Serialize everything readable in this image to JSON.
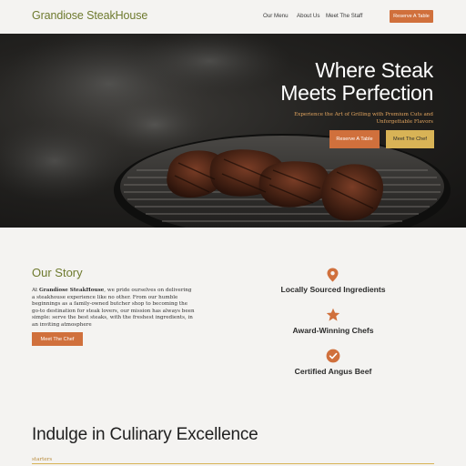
{
  "nav": {
    "brand": "Grandiose SteakHouse",
    "links": [
      "Our Menu",
      "About Us",
      "Meet The Staff"
    ],
    "cta": "Reserve A Table"
  },
  "hero": {
    "title_line1": "Where Steak",
    "title_line2": "Meets Perfection",
    "subtitle": "Experience the Art of Grilling with Premium Cuts and Unforgettable Flavors",
    "primary_button": "Reserve A Table",
    "secondary_button": "Meet The Chef"
  },
  "story": {
    "title": "Our Story",
    "text_prefix": "At ",
    "text_bold": "Grandiose SteakHouse",
    "text_rest": ", we pride ourselves on delivering a steakhouse experience like no other. From our humble beginnings as a family-owned butcher shop to becoming the go-to destination for steak lovers, our mission has always been simple: serve the best steaks, with the freshest ingredients, in an inviting atmosphere",
    "button": "Meet The Chef"
  },
  "features": [
    {
      "icon": "location-pin-icon",
      "label": "Locally Sourced Ingredients"
    },
    {
      "icon": "star-icon",
      "label": "Award-Winning Chefs"
    },
    {
      "icon": "badge-check-icon",
      "label": "Certified Angus Beef"
    }
  ],
  "menu": {
    "title": "Indulge in Culinary Excellence",
    "category": "starters"
  },
  "colors": {
    "brand_green": "#6e7a2e",
    "accent_orange": "#d0703c",
    "accent_gold": "#d8b356",
    "background": "#f4f3f1"
  }
}
